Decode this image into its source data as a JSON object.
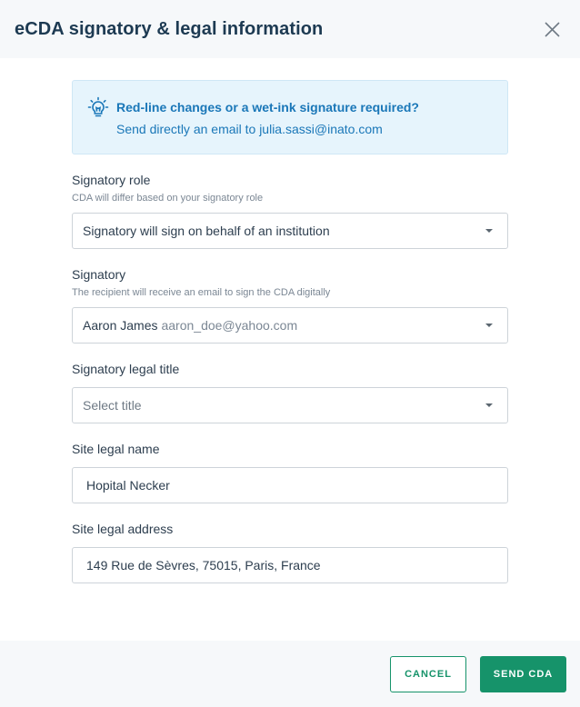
{
  "header": {
    "title": "eCDA signatory & legal information",
    "close_icon": "close-icon"
  },
  "info": {
    "icon": "lightbulb-icon",
    "title": "Red-line changes or a wet-ink signature required?",
    "text": "Send directly an email to julia.sassi@inato.com"
  },
  "fields": {
    "signatory_role": {
      "label": "Signatory role",
      "help": "CDA will differ based on your signatory role",
      "value": "Signatory will sign on behalf of an institution"
    },
    "signatory": {
      "label": "Signatory",
      "help": "The recipient will receive an email to sign the CDA digitally",
      "name": "Aaron James",
      "email": "aaron_doe@yahoo.com"
    },
    "legal_title": {
      "label": "Signatory legal title",
      "placeholder": "Select title"
    },
    "site_name": {
      "label": "Site legal name",
      "value": "Hopital Necker"
    },
    "site_address": {
      "label": "Site legal address",
      "value": "149 Rue de Sèvres, 75015, Paris, France"
    }
  },
  "footer": {
    "cancel_label": "CANCEL",
    "send_label": "SEND CDA"
  },
  "colors": {
    "accent": "#16936a",
    "info_blue": "#1a77b8",
    "info_bg": "#e6f4fc",
    "title": "#1d3a52"
  }
}
